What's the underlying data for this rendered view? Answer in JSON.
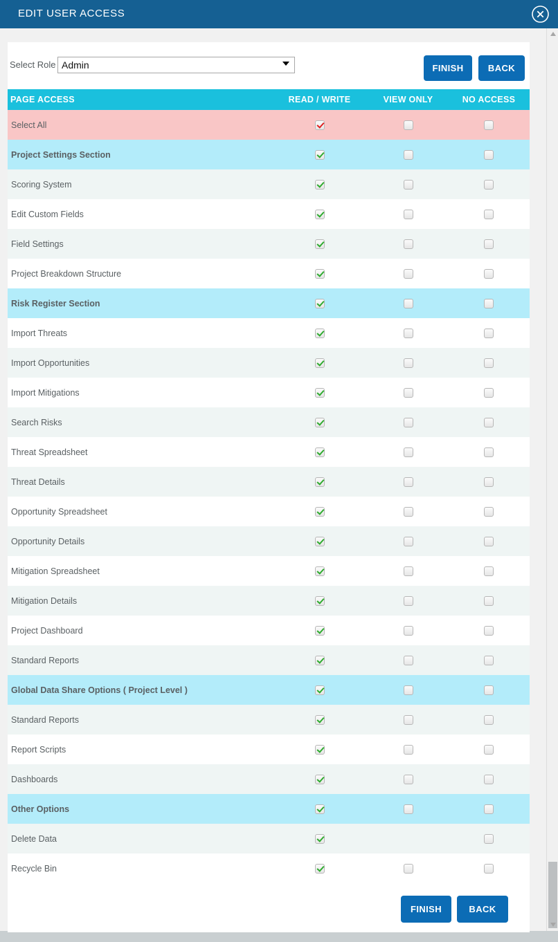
{
  "window": {
    "title": "EDIT USER ACCESS",
    "close_icon": "close-circle-icon"
  },
  "colors": {
    "titlebar": "#156093",
    "table_header": "#1ac0dd",
    "select_all_row": "#f9c6c6",
    "section_row": "#b3ecfa",
    "row_alt": "#eff5f4",
    "button": "#0c6cb5",
    "check_green": "#2eab2e",
    "check_red": "#e02020"
  },
  "toolbar": {
    "role_label": "Select Role :",
    "role_value": "Admin",
    "role_options": [
      "Admin"
    ],
    "finish_label": "FINISH",
    "back_label": "BACK"
  },
  "table": {
    "headers": {
      "page_access": "PAGE ACCESS",
      "read_write": "READ / WRITE",
      "view_only": "VIEW ONLY",
      "no_access": "NO ACCESS"
    },
    "rows": [
      {
        "label": "Select All",
        "type": "selectall",
        "read_write": "checked-red",
        "view_only": "unchecked",
        "no_access": "unchecked"
      },
      {
        "label": "Project Settings Section",
        "type": "section",
        "read_write": "checked",
        "view_only": "unchecked",
        "no_access": "unchecked"
      },
      {
        "label": "Scoring System",
        "type": "item",
        "read_write": "checked",
        "view_only": "unchecked",
        "no_access": "unchecked"
      },
      {
        "label": "Edit Custom Fields",
        "type": "item",
        "read_write": "checked",
        "view_only": "unchecked",
        "no_access": "unchecked"
      },
      {
        "label": "Field Settings",
        "type": "item",
        "read_write": "checked",
        "view_only": "unchecked",
        "no_access": "unchecked"
      },
      {
        "label": "Project Breakdown Structure",
        "type": "item",
        "read_write": "checked",
        "view_only": "unchecked",
        "no_access": "unchecked"
      },
      {
        "label": "Risk Register Section",
        "type": "section",
        "read_write": "checked",
        "view_only": "unchecked",
        "no_access": "unchecked"
      },
      {
        "label": "Import Threats",
        "type": "item",
        "read_write": "checked",
        "view_only": "unchecked",
        "no_access": "unchecked"
      },
      {
        "label": "Import Opportunities",
        "type": "item",
        "read_write": "checked",
        "view_only": "unchecked",
        "no_access": "unchecked"
      },
      {
        "label": "Import Mitigations",
        "type": "item",
        "read_write": "checked",
        "view_only": "unchecked",
        "no_access": "unchecked"
      },
      {
        "label": "Search Risks",
        "type": "item",
        "read_write": "checked",
        "view_only": "unchecked",
        "no_access": "unchecked"
      },
      {
        "label": "Threat Spreadsheet",
        "type": "item",
        "read_write": "checked",
        "view_only": "unchecked",
        "no_access": "unchecked"
      },
      {
        "label": "Threat Details",
        "type": "item",
        "read_write": "checked",
        "view_only": "unchecked",
        "no_access": "unchecked"
      },
      {
        "label": "Opportunity Spreadsheet",
        "type": "item",
        "read_write": "checked",
        "view_only": "unchecked",
        "no_access": "unchecked"
      },
      {
        "label": "Opportunity Details",
        "type": "item",
        "read_write": "checked",
        "view_only": "unchecked",
        "no_access": "unchecked"
      },
      {
        "label": "Mitigation Spreadsheet",
        "type": "item",
        "read_write": "checked",
        "view_only": "unchecked",
        "no_access": "unchecked"
      },
      {
        "label": "Mitigation Details",
        "type": "item",
        "read_write": "checked",
        "view_only": "unchecked",
        "no_access": "unchecked"
      },
      {
        "label": "Project Dashboard",
        "type": "item",
        "read_write": "checked",
        "view_only": "unchecked",
        "no_access": "unchecked"
      },
      {
        "label": "Standard Reports",
        "type": "item",
        "read_write": "checked",
        "view_only": "unchecked",
        "no_access": "unchecked"
      },
      {
        "label": "Global Data Share Options ( Project Level )",
        "type": "section",
        "read_write": "checked",
        "view_only": "unchecked",
        "no_access": "unchecked"
      },
      {
        "label": "Standard Reports",
        "type": "item",
        "read_write": "checked",
        "view_only": "unchecked",
        "no_access": "unchecked"
      },
      {
        "label": "Report Scripts",
        "type": "item",
        "read_write": "checked",
        "view_only": "unchecked",
        "no_access": "unchecked"
      },
      {
        "label": "Dashboards",
        "type": "item",
        "read_write": "checked",
        "view_only": "unchecked",
        "no_access": "unchecked"
      },
      {
        "label": "Other Options",
        "type": "section",
        "read_write": "checked",
        "view_only": "unchecked",
        "no_access": "unchecked"
      },
      {
        "label": "Delete Data",
        "type": "item",
        "read_write": "checked",
        "view_only": "none",
        "no_access": "unchecked"
      },
      {
        "label": "Recycle Bin",
        "type": "item",
        "read_write": "checked",
        "view_only": "unchecked",
        "no_access": "unchecked"
      }
    ]
  },
  "footer": {
    "finish_label": "FINISH",
    "back_label": "BACK"
  },
  "scrollbar": {
    "up_arrow_icon": "caret-up-icon",
    "down_arrow_icon": "caret-down-icon"
  }
}
